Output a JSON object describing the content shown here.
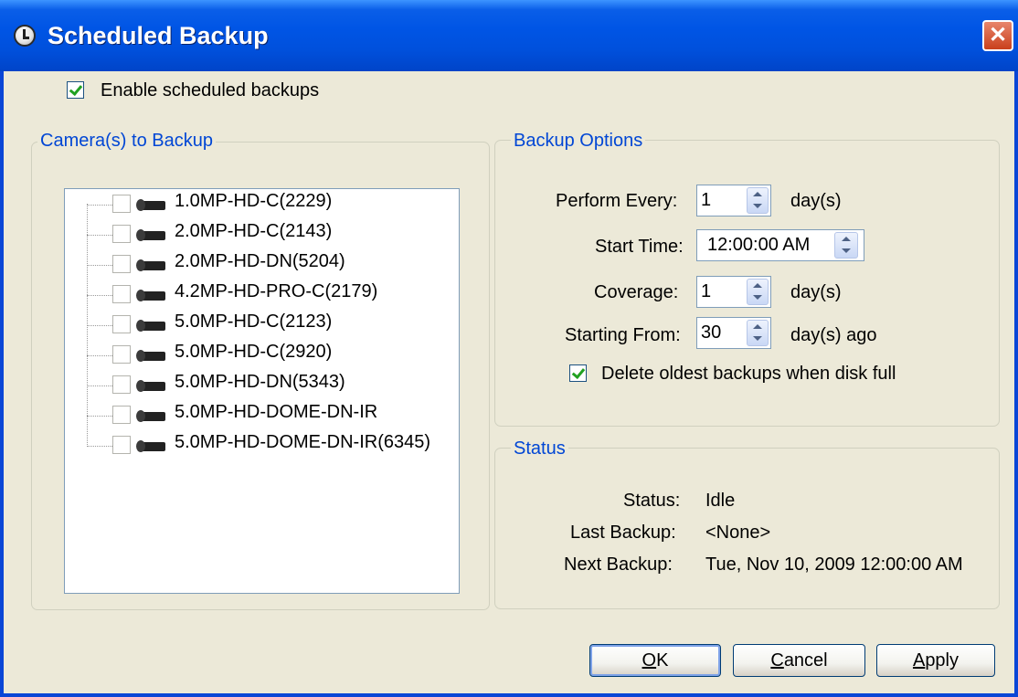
{
  "window": {
    "title": "Scheduled Backup",
    "close_glyph": "✕"
  },
  "enable": {
    "label": "Enable scheduled backups",
    "checked": true
  },
  "cameras_group": {
    "title": "Camera(s) to Backup",
    "cameras": [
      {
        "label": "1.0MP-HD-C(2229)",
        "checked": false
      },
      {
        "label": "2.0MP-HD-C(2143)",
        "checked": false
      },
      {
        "label": "2.0MP-HD-DN(5204)",
        "checked": false
      },
      {
        "label": "4.2MP-HD-PRO-C(2179)",
        "checked": false
      },
      {
        "label": "5.0MP-HD-C(2123)",
        "checked": false
      },
      {
        "label": "5.0MP-HD-C(2920)",
        "checked": false
      },
      {
        "label": "5.0MP-HD-DN(5343)",
        "checked": false
      },
      {
        "label": "5.0MP-HD-DOME-DN-IR",
        "checked": false
      },
      {
        "label": "5.0MP-HD-DOME-DN-IR(6345)",
        "checked": false
      }
    ]
  },
  "options_group": {
    "title": "Backup Options",
    "perform_every": {
      "label": "Perform Every:",
      "value": "1",
      "unit": "day(s)"
    },
    "start_time": {
      "label": "Start Time:",
      "value": "12:00:00  AM"
    },
    "coverage": {
      "label": "Coverage:",
      "value": "1",
      "unit": "day(s)"
    },
    "starting_from": {
      "label": "Starting From:",
      "value": "30",
      "unit": "day(s) ago"
    },
    "delete_oldest": {
      "label": "Delete oldest backups when disk full",
      "checked": true
    }
  },
  "status_group": {
    "title": "Status",
    "status": {
      "label": "Status:",
      "value": "Idle"
    },
    "last_backup": {
      "label": "Last Backup:",
      "value": "<None>"
    },
    "next_backup": {
      "label": "Next Backup:",
      "value": "Tue, Nov 10, 2009 12:00:00 AM"
    }
  },
  "buttons": {
    "ok": {
      "mnemonic": "O",
      "rest": "K"
    },
    "cancel": {
      "mnemonic": "C",
      "rest": "ancel"
    },
    "apply": {
      "mnemonic": "A",
      "rest": "pply"
    }
  },
  "colors": {
    "titlebar": "#0055e5",
    "group_title": "#0046d5",
    "dialog_bg": "#ece9d8",
    "check_mark": "#21a121"
  }
}
